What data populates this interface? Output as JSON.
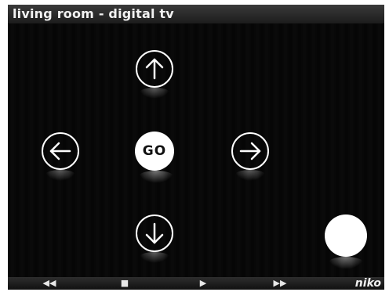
{
  "window": {
    "title": "living room - digital tv"
  },
  "remote": {
    "up": {
      "icon": "arrow-up-icon"
    },
    "left": {
      "icon": "arrow-left-icon"
    },
    "go": {
      "label": "GO"
    },
    "right": {
      "icon": "arrow-right-icon"
    },
    "down": {
      "icon": "arrow-down-icon"
    },
    "refresh": {
      "icon": "refresh-icon"
    }
  },
  "transport": {
    "rewind": "◀◀",
    "stop": "■",
    "play": "▶",
    "fast_forward": "▶▶"
  },
  "brand": {
    "logo": "niko"
  },
  "colors": {
    "background": "#000000",
    "button": "#ffffff",
    "bar": "#2a2a2a"
  }
}
